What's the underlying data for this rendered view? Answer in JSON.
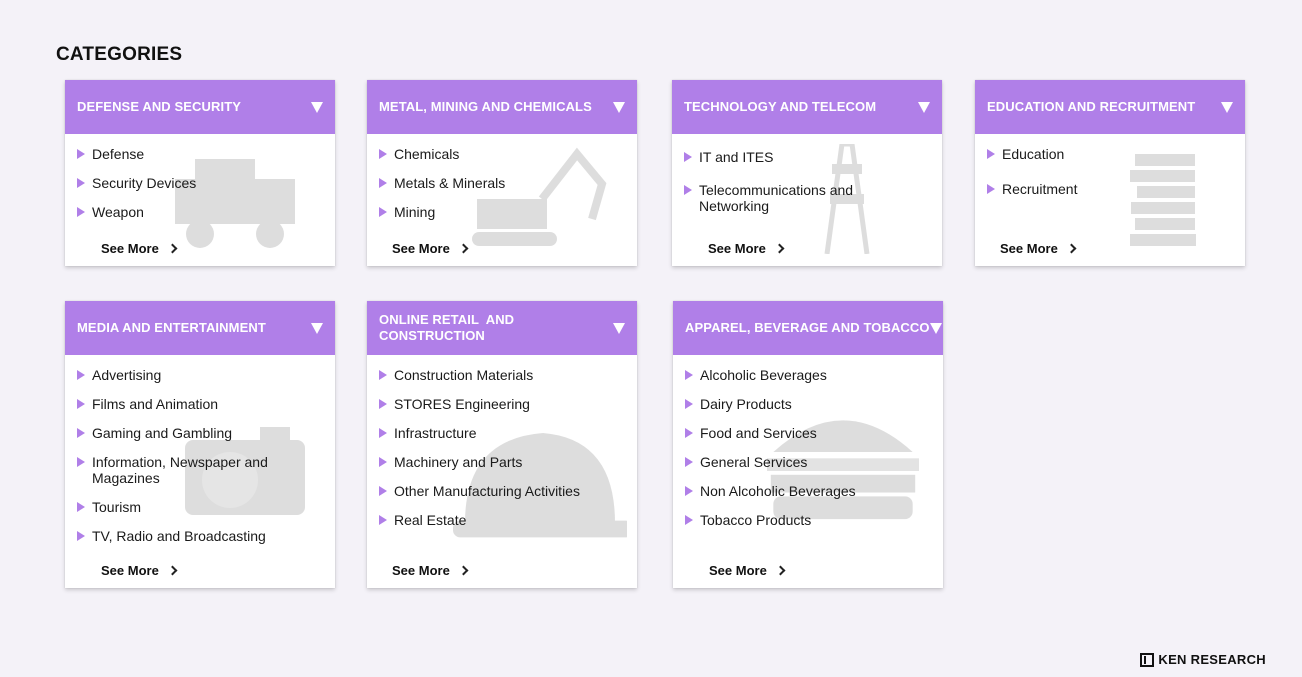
{
  "page": {
    "title": "CATEGORIES"
  },
  "see_more_label": "See More",
  "accent_color": "#b07fe8",
  "cards": [
    {
      "title": "DEFENSE AND SECURITY",
      "art": "armored-vehicle",
      "items": [
        "Defense",
        "Security Devices",
        "Weapon"
      ]
    },
    {
      "title": "METAL, MINING AND CHEMICALS",
      "art": "excavator",
      "items": [
        "Chemicals",
        "Metals & Minerals",
        "Mining"
      ]
    },
    {
      "title": "TECHNOLOGY AND TELECOM",
      "art": "telecom-tower",
      "items": [
        "IT and ITES",
        "Telecommunications and Networking"
      ]
    },
    {
      "title": "EDUCATION AND RECRUITMENT",
      "art": "books",
      "items": [
        "Education",
        "Recruitment"
      ]
    },
    {
      "title": "MEDIA AND ENTERTAINMENT",
      "art": "camera",
      "items": [
        "Advertising",
        "Films and Animation",
        "Gaming and Gambling",
        "Information, Newspaper and Magazines",
        "Tourism",
        "TV, Radio and Broadcasting"
      ]
    },
    {
      "title": "ONLINE RETAIL  AND CONSTRUCTION",
      "art": "hard-hat",
      "items": [
        "Construction Materials",
        "STORES Engineering",
        "Infrastructure",
        "Machinery and Parts",
        "Other Manufacturing Activities",
        "Real Estate"
      ]
    },
    {
      "title": "APPAREL, BEVERAGE AND TOBACCO",
      "art": "burger",
      "items": [
        "Alcoholic Beverages",
        "Dairy Products",
        "Food and Services",
        "General Services",
        "Non Alcoholic Beverages",
        "Tobacco Products"
      ]
    }
  ],
  "logo": {
    "text": "KEN RESEARCH"
  }
}
